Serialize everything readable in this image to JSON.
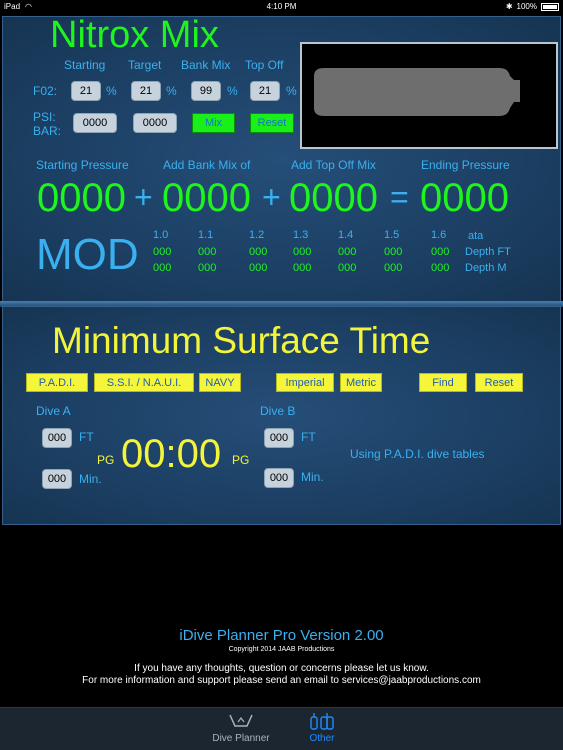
{
  "status_bar": {
    "device": "iPad",
    "time": "4:10 PM",
    "battery": "100%"
  },
  "nitrox": {
    "title": "Nitrox Mix",
    "col_headers": [
      "Starting",
      "Target",
      "Bank Mix",
      "Top Off"
    ],
    "fo2_label": "F02:",
    "fo2_values": [
      "21",
      "21",
      "99",
      "21"
    ],
    "pct": "%",
    "psi_label": "PSI:",
    "bar_label": "BAR:",
    "psi_values": [
      "0000",
      "0000"
    ],
    "mix_button": "Mix",
    "reset_button": "Reset",
    "pressure_headers": [
      "Starting Pressure",
      "Add Bank Mix of",
      "Add Top Off Mix",
      "Ending Pressure"
    ],
    "pressures": [
      "0000",
      "0000",
      "0000",
      "0000"
    ],
    "plus": "+",
    "equals": "=",
    "mod_label": "MOD",
    "mod_ata": [
      "1.0",
      "1.1",
      "1.2",
      "1.3",
      "1.4",
      "1.5",
      "1.6"
    ],
    "ata_label": "ata",
    "depth_ft": [
      "000",
      "000",
      "000",
      "000",
      "000",
      "000",
      "000"
    ],
    "depth_ft_label": "Depth FT",
    "depth_m": [
      "000",
      "000",
      "000",
      "000",
      "000",
      "000",
      "000"
    ],
    "depth_m_label": "Depth M"
  },
  "surface": {
    "title": "Minimum Surface Time",
    "buttons": [
      "P.A.D.I.",
      "S.S.I. / N.A.U.I.",
      "NAVY",
      "Imperial",
      "Metric",
      "Find",
      "Reset"
    ],
    "dive_a_label": "Dive A",
    "dive_b_label": "Dive B",
    "dive_a_depth": "000",
    "dive_a_time": "000",
    "dive_b_depth": "000",
    "dive_b_time": "000",
    "ft_label": "FT",
    "min_label": "Min.",
    "pg_label": "PG",
    "time": "00:00",
    "tables_note": "Using P.A.D.I. dive tables"
  },
  "footer": {
    "version": "iDive Planner Pro Version 2.00",
    "copyright": "Copyright 2014 JAAB Productions",
    "line1": "If you have any thoughts, question or concerns please let us know.",
    "line2": "For more information and support please send an email to services@jaabproductions.com"
  },
  "tabs": [
    {
      "label": "Dive Planner",
      "icon": "dive-planner-icon"
    },
    {
      "label": "Other",
      "icon": "tanks-icon"
    }
  ]
}
